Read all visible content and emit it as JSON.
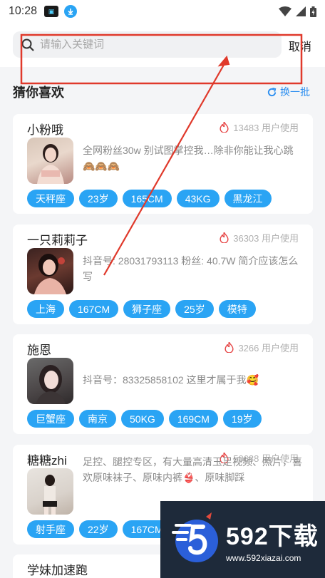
{
  "status_bar": {
    "time": "10:28",
    "app_icon": "app-badge-icon",
    "download_icon": "download-icon"
  },
  "search": {
    "placeholder": "请输入关键词",
    "cancel_label": "取消"
  },
  "section": {
    "title": "猜你喜欢",
    "refresh_label": "换一批"
  },
  "usage_suffix": "用户使用",
  "cards": [
    {
      "name": "小粉哦",
      "usage": "13483 用户使用",
      "desc": "全网粉丝30w 别试图掌控我…除非你能让我心跳🙈🙈🙈",
      "tags": [
        "天秤座",
        "23岁",
        "165CM",
        "43KG",
        "黑龙江"
      ]
    },
    {
      "name": "一只莉莉子",
      "usage": "36303 用户使用",
      "desc": "抖音号: 28031793113 粉丝: 40.7W 简介应该怎么写",
      "tags": [
        "上海",
        "167CM",
        "狮子座",
        "25岁",
        "模特"
      ]
    },
    {
      "name": "施恩",
      "usage": "3266 用户使用",
      "desc": "抖音号：83325858102 这里才属于我🥰",
      "tags": [
        "巨蟹座",
        "南京",
        "50KG",
        "169CM",
        "19岁"
      ]
    },
    {
      "name": "糖糖zhi",
      "usage": "50638 用户使用",
      "desc": "足控、腿控专区，有大量高清玉足视频、照片，喜欢原味袜子、原味内裤👙、原味脚踩",
      "tags": [
        "射手座",
        "22岁",
        "167CM"
      ]
    },
    {
      "name": "学妹加速跑",
      "usage": "",
      "desc": "",
      "tags": []
    }
  ],
  "watermark": {
    "brand": "592下载",
    "url": "www.592xiazai.com"
  },
  "colors": {
    "accent": "#2aa4f4",
    "annotation": "#e0392b",
    "fire": "#e64545"
  }
}
